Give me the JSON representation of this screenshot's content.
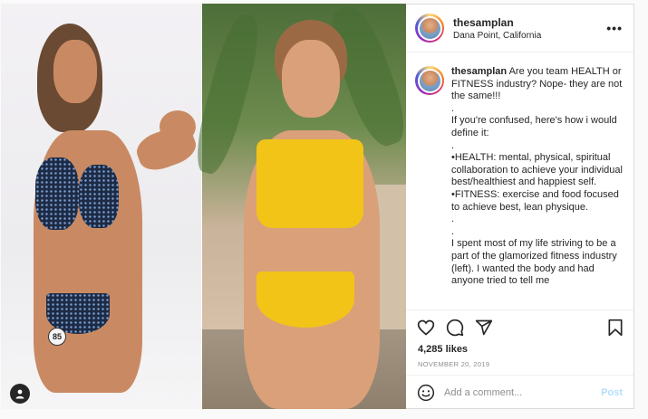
{
  "post": {
    "username": "thesamplan",
    "location": "Dana Point, California",
    "caption": "Are you team HEALTH or FITNESS industry? Nope- they are not the same!!!\n.\nIf you're confused, here's how i would define it:\n.\n•HEALTH: mental, physical, spiritual collaboration to achieve your individual best/healthiest and happiest self.\n•FITNESS: exercise and food focused to achieve best, lean physique.\n.\n.\nI spent most of my life striving to be a part of the glamorized fitness industry (left). I wanted the body and had anyone tried to tell me",
    "likes": "4,285 likes",
    "date": "NOVEMBER 20, 2019",
    "photo_badge": "85"
  },
  "comment": {
    "placeholder": "Add a comment...",
    "post_label": "Post"
  },
  "icons": {
    "more": "more-options-icon",
    "like": "heart-icon",
    "comment": "comment-icon",
    "share": "share-icon",
    "save": "bookmark-icon",
    "emoji": "emoji-icon",
    "tag": "user-tag-icon"
  },
  "colors": {
    "bikini_left": "#1d2b45",
    "bikini_right": "#f2c418",
    "post_button": "#b2dffc",
    "text": "#262626",
    "muted": "#8e8e8e"
  }
}
